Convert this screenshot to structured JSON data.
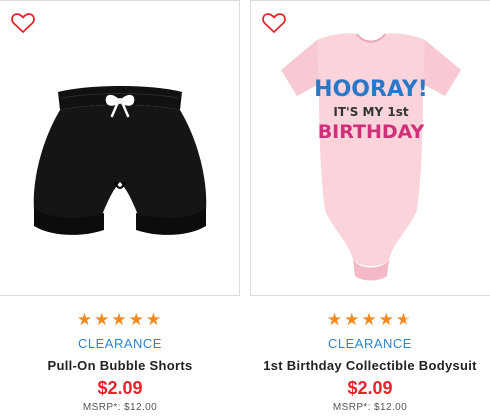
{
  "products": [
    {
      "badge": "CLEARANCE",
      "name": "Pull-On Bubble Shorts",
      "price": "$2.09",
      "msrp": "MSRP*: $12.00",
      "rating": 5,
      "image": "black-bubble-shorts",
      "favorite_icon": "heart-outline-icon"
    },
    {
      "badge": "CLEARANCE",
      "name": "1st Birthday Collectible Bodysuit",
      "price": "$2.09",
      "msrp": "MSRP*: $12.00",
      "rating": 4.5,
      "image": "pink-birthday-bodysuit",
      "print_lines": [
        "HOORAY!",
        "IT'S MY 1st",
        "BIRTHDAY"
      ],
      "favorite_icon": "heart-outline-icon"
    }
  ],
  "colors": {
    "accent_price": "#e4262c",
    "badge": "#2e86d1",
    "star": "#f48a1f",
    "heart": "#e4262c"
  }
}
